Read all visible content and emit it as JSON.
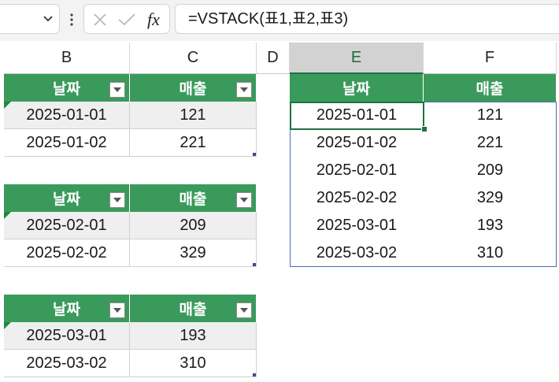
{
  "formula_bar": {
    "cancel_icon": "x-icon",
    "confirm_icon": "check-icon",
    "fx_label": "fx",
    "formula": "=VSTACK(표1,표2,표3)"
  },
  "columns": [
    "B",
    "C",
    "D",
    "E",
    "F"
  ],
  "selected_column": "E",
  "tables": [
    {
      "headers": [
        "날짜",
        "매출"
      ],
      "rows": [
        [
          "2025-01-01",
          "121"
        ],
        [
          "2025-01-02",
          "221"
        ]
      ]
    },
    {
      "headers": [
        "날짜",
        "매출"
      ],
      "rows": [
        [
          "2025-02-01",
          "209"
        ],
        [
          "2025-02-02",
          "329"
        ]
      ]
    },
    {
      "headers": [
        "날짜",
        "매출"
      ],
      "rows": [
        [
          "2025-03-01",
          "193"
        ],
        [
          "2025-03-02",
          "310"
        ]
      ]
    }
  ],
  "spill": {
    "headers": [
      "날짜",
      "매출"
    ],
    "rows": [
      [
        "2025-01-01",
        "121"
      ],
      [
        "2025-01-02",
        "221"
      ],
      [
        "2025-02-01",
        "209"
      ],
      [
        "2025-02-02",
        "329"
      ],
      [
        "2025-03-01",
        "193"
      ],
      [
        "2025-03-02",
        "310"
      ]
    ]
  },
  "colors": {
    "header_green": "#3a9a5b",
    "selection_green": "#1e7145",
    "spill_border": "#4a6db3"
  }
}
